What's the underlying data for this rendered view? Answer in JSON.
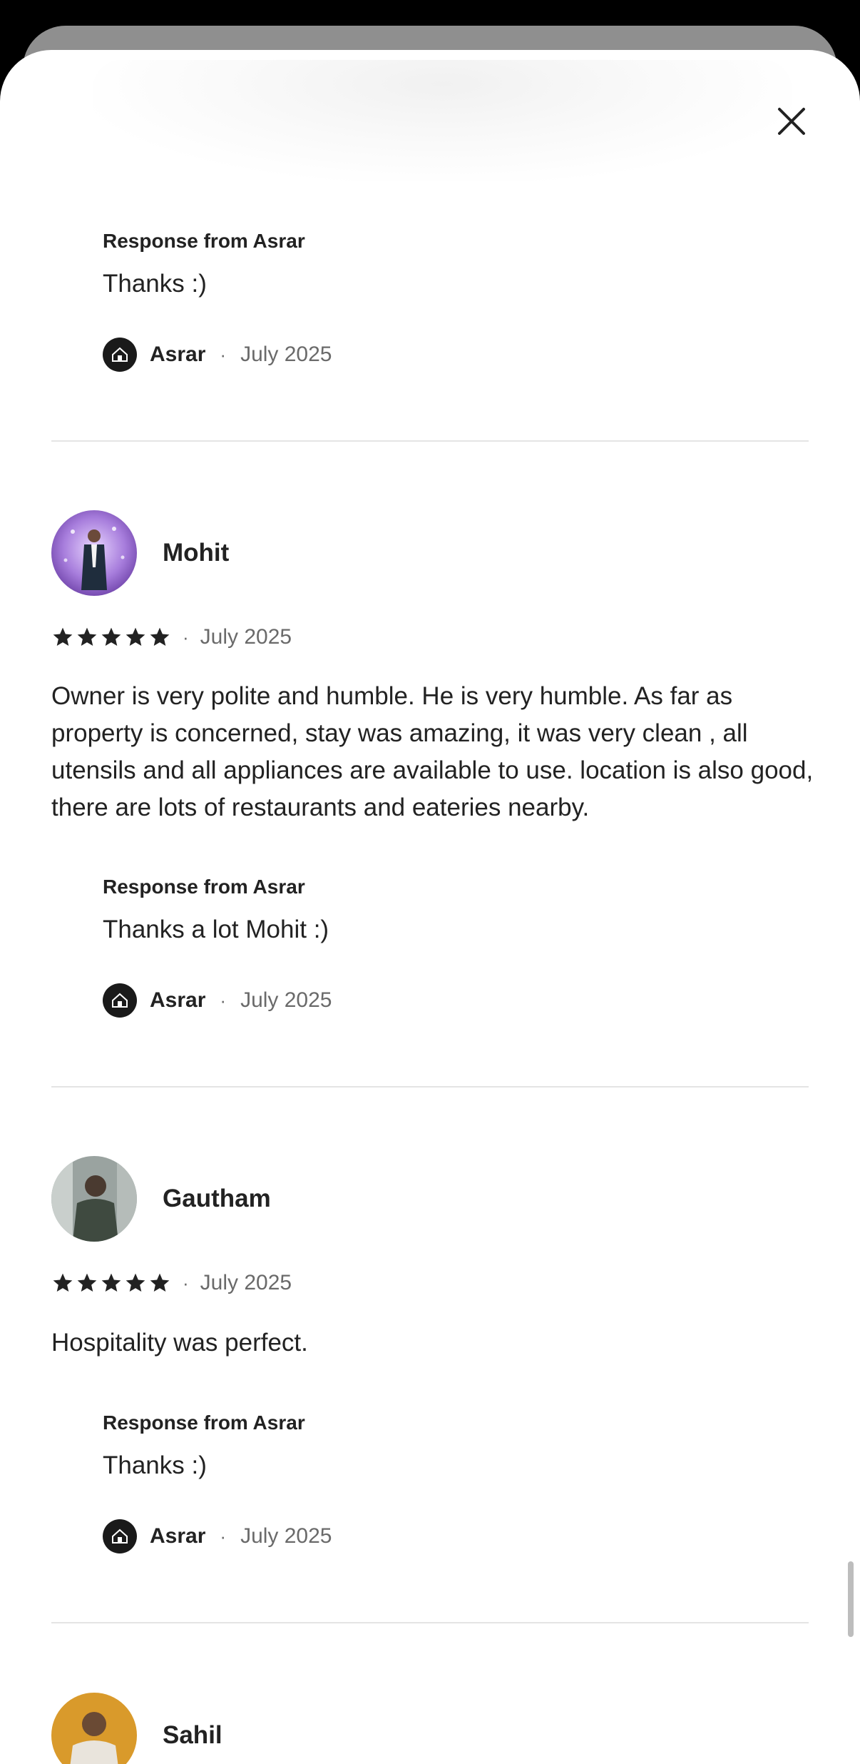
{
  "modal": {
    "close_icon": "close-icon"
  },
  "responses": [
    {
      "title": "Response from Asrar",
      "text": "Thanks :)",
      "host": "Asrar",
      "date": "July 2025"
    },
    {
      "title": "Response from Asrar",
      "text": "Thanks a lot Mohit :)",
      "host": "Asrar",
      "date": "July 2025"
    },
    {
      "title": "Response from Asrar",
      "text": "Thanks :)",
      "host": "Asrar",
      "date": "July 2025"
    }
  ],
  "reviews": [
    {
      "name": "Mohit",
      "rating": 5,
      "date": "July 2025",
      "text": "Owner is very polite and humble. He is very humble. As far as property is concerned, stay was amazing, it was very clean , all utensils and all appliances are available to use. location is also good, there are lots of restaurants and eateries nearby."
    },
    {
      "name": "Gautham",
      "rating": 5,
      "date": "July 2025",
      "text": "Hospitality was perfect."
    },
    {
      "name": "Sahil"
    }
  ],
  "separator": "·",
  "colors": {
    "text": "#222222",
    "muted": "#6a6a6a",
    "divider": "#e4e4e4"
  }
}
